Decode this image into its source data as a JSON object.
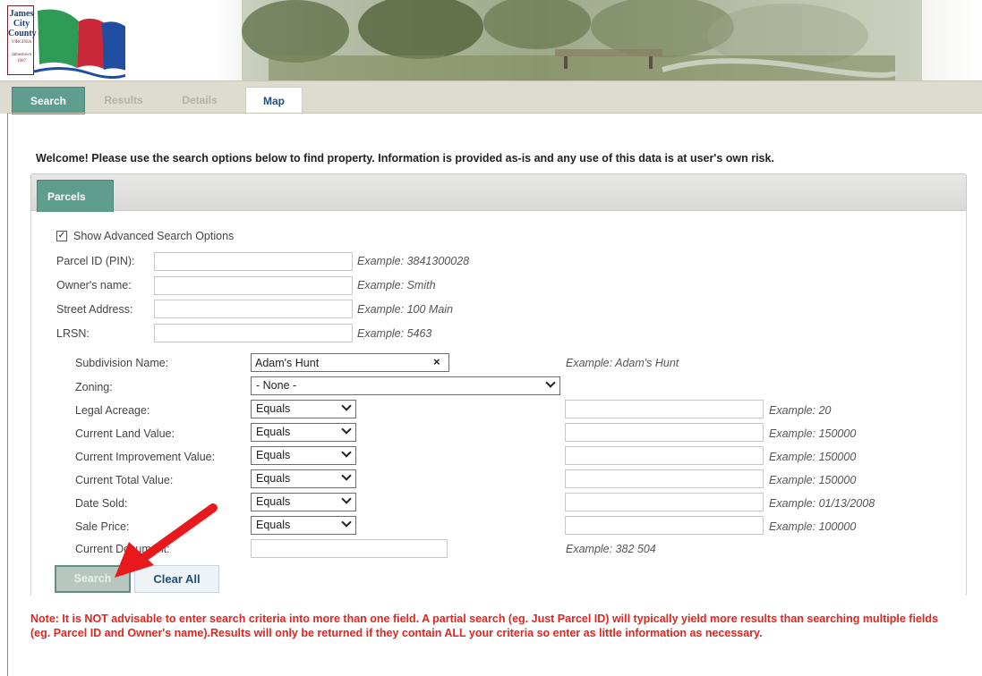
{
  "header": {
    "logo_lines": [
      "James",
      "City",
      "County"
    ],
    "logo_small": [
      "VIRGINIA",
      "Jamestown",
      "1607"
    ]
  },
  "tabs": [
    {
      "label": "Search",
      "state": "active"
    },
    {
      "label": "Results",
      "state": "disabled"
    },
    {
      "label": "Details",
      "state": "disabled"
    },
    {
      "label": "Map",
      "state": "normal"
    }
  ],
  "welcome": "Welcome! Please use the search options below to find property. Information is provided as-is and any use of this data is at user's own risk.",
  "subtab": "Parcels",
  "advanced": {
    "label": "Show Advanced Search Options",
    "checked": true,
    "check_glyph": "✓"
  },
  "basic_fields": [
    {
      "label": "Parcel ID (PIN):",
      "value": "",
      "example": "Example: 3841300028"
    },
    {
      "label": "Owner's name:",
      "value": "",
      "example": "Example: Smith"
    },
    {
      "label": "Street Address:",
      "value": "",
      "example": "Example: 100 Main"
    },
    {
      "label": "LRSN:",
      "value": "",
      "example": "Example: 5463"
    }
  ],
  "subdivision": {
    "label": "Subdivision Name:",
    "value": "Adam's Hunt",
    "clear_glyph": "×",
    "example": "Example: Adam's Hunt"
  },
  "zoning": {
    "label": "Zoning:",
    "selected": "- None -"
  },
  "advanced_fields": [
    {
      "label": "Legal Acreage:",
      "operator": "Equals",
      "value": "",
      "example": "Example: 20"
    },
    {
      "label": "Current Land Value:",
      "operator": "Equals",
      "value": "",
      "example": "Example: 150000"
    },
    {
      "label": "Current Improvement Value:",
      "operator": "Equals",
      "value": "",
      "example": "Example: 150000"
    },
    {
      "label": "Current Total Value:",
      "operator": "Equals",
      "value": "",
      "example": "Example: 150000"
    },
    {
      "label": "Date Sold:",
      "operator": "Equals",
      "value": "",
      "example": "Example: 01/13/2008"
    },
    {
      "label": "Sale Price:",
      "operator": "Equals",
      "value": "",
      "example": "Example: 100000"
    }
  ],
  "current_document": {
    "label": "Current Document:",
    "value": "",
    "example": "Example: 382 504"
  },
  "buttons": {
    "search": "Search",
    "clear": "Clear All"
  },
  "note": "Note: It is NOT advisable to enter search criteria into more than one field. A partial search (eg. Just Parcel ID) will typically yield more results than searching multiple fields (eg. Parcel ID and Owner's name).Results will only be returned if they contain ALL your criteria so enter as little information as necessary.",
  "colors": {
    "tab_active": "#5f9e8f",
    "note_red": "#e0261f",
    "arrow_red": "#e8191c",
    "link_blue": "#1f4f7a"
  }
}
